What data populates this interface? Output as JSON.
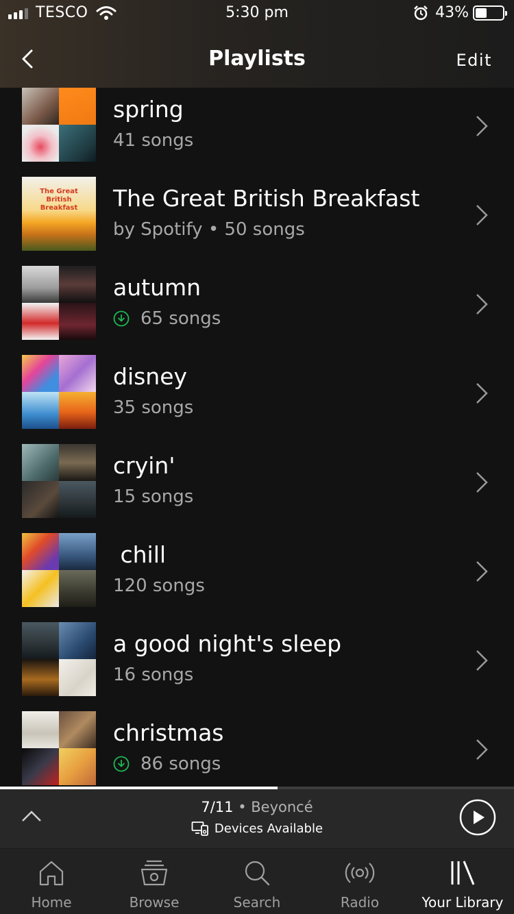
{
  "status_bar": {
    "carrier": "TESCO",
    "time": "5:30 pm",
    "battery_percent": "43%",
    "battery_level": 0.43
  },
  "header": {
    "title": "Playlists",
    "edit_label": "Edit"
  },
  "playlists": [
    {
      "title": "spring",
      "subtitle": "41 songs",
      "downloaded": false
    },
    {
      "title": "The Great British Breakfast",
      "subtitle": "by Spotify • 50 songs",
      "downloaded": false,
      "cover_text": "The Great British Breakfast"
    },
    {
      "title": "autumn",
      "subtitle": "65 songs",
      "downloaded": true
    },
    {
      "title": "disney",
      "subtitle": "35 songs",
      "downloaded": false
    },
    {
      "title": "cryin'",
      "subtitle": "15 songs",
      "downloaded": false
    },
    {
      "title": " chill",
      "subtitle": "120 songs",
      "downloaded": false
    },
    {
      "title": "a good night's sleep",
      "subtitle": "16 songs",
      "downloaded": false
    },
    {
      "title": "christmas",
      "subtitle": "86 songs",
      "downloaded": true
    }
  ],
  "now_playing": {
    "track": "7/11",
    "separator": " • ",
    "artist": "Beyoncé",
    "devices_label": "Devices Available",
    "progress": 0.54
  },
  "tabs": [
    {
      "label": "Home",
      "icon": "home-icon",
      "active": false
    },
    {
      "label": "Browse",
      "icon": "browse-icon",
      "active": false
    },
    {
      "label": "Search",
      "icon": "search-icon",
      "active": false
    },
    {
      "label": "Radio",
      "icon": "radio-icon",
      "active": false
    },
    {
      "label": "Your Library",
      "icon": "library-icon",
      "active": true
    }
  ],
  "colors": {
    "background": "#121212",
    "download_green": "#1db954",
    "secondary_text": "#a8a8a8"
  }
}
